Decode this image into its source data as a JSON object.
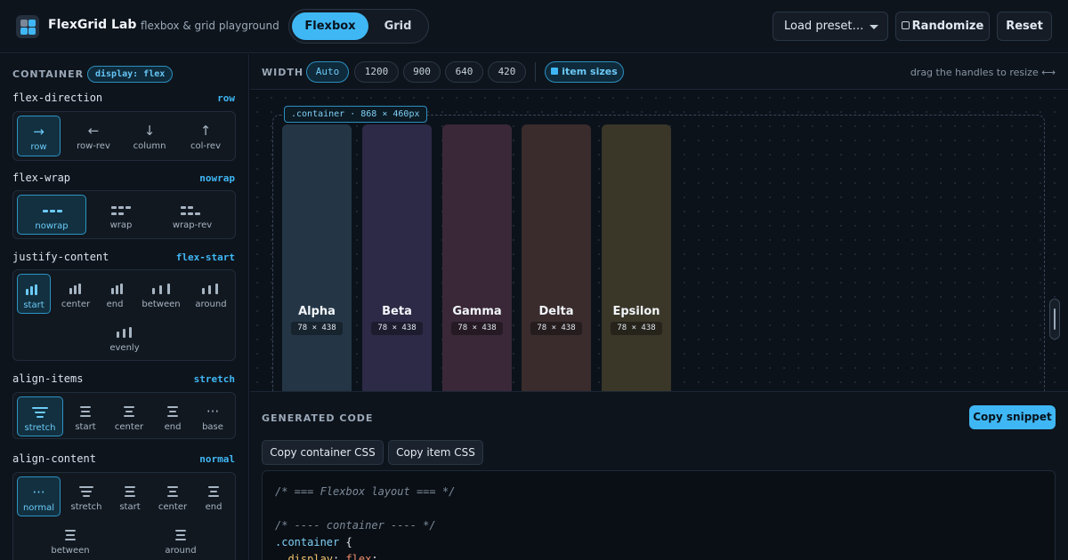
{
  "header": {
    "title": "FlexGrid Lab",
    "subtitle": "flexbox & grid playground",
    "modes": [
      "Flexbox",
      "Grid"
    ],
    "active_mode": "Flexbox",
    "preset_label": "Load preset…",
    "randomize_label": "Randomize",
    "reset_label": "Reset"
  },
  "sidebar": {
    "section": "CONTAINER",
    "badge": "display: flex",
    "flex_direction": {
      "name": "flex-direction",
      "value": "row",
      "options": [
        "row",
        "row-rev",
        "column",
        "col-rev"
      ]
    },
    "flex_wrap": {
      "name": "flex-wrap",
      "value": "nowrap",
      "options": [
        "nowrap",
        "wrap",
        "wrap-rev"
      ]
    },
    "justify_content": {
      "name": "justify-content",
      "value": "flex-start",
      "options": [
        "start",
        "center",
        "end",
        "between",
        "around",
        "evenly"
      ]
    },
    "align_items": {
      "name": "align-items",
      "value": "stretch",
      "options": [
        "stretch",
        "start",
        "center",
        "end",
        "base"
      ]
    },
    "align_content": {
      "name": "align-content",
      "value": "normal",
      "options": [
        "normal",
        "stretch",
        "start",
        "center",
        "end",
        "between",
        "around"
      ]
    }
  },
  "toolbar": {
    "label": "WIDTH",
    "widths": [
      "Auto",
      "1200",
      "900",
      "640",
      "420"
    ],
    "selected_width": "Auto",
    "item_sizes_label": "item sizes",
    "hint": "drag the handles to resize ⟷"
  },
  "canvas": {
    "container_tag": ".container · 868 × 460px",
    "items": [
      {
        "name": "Alpha",
        "size": "78 × 438",
        "color": "#243646"
      },
      {
        "name": "Beta",
        "size": "78 × 438",
        "color": "#2d2a47"
      },
      {
        "name": "Gamma",
        "size": "78 × 438",
        "color": "#3a2838"
      },
      {
        "name": "Delta",
        "size": "78 × 438",
        "color": "#3a2c2d"
      },
      {
        "name": "Epsilon",
        "size": "78 × 438",
        "color": "#3a3729"
      }
    ]
  },
  "code_panel": {
    "title": "GENERATED CODE",
    "copy_snippet_label": "Copy snippet",
    "copy_container_label": "Copy container CSS",
    "copy_item_label": "Copy item CSS",
    "lines": {
      "l1": "/* === Flexbox layout === */",
      "l2": "/* ---- container ---- */",
      "l3_selector": ".container",
      "l3_brace": " {",
      "l4_prop": "display",
      "l4_value": "flex"
    }
  },
  "colors": {
    "accent": "#3fb7f4",
    "background": "#0b1017",
    "panel": "#0e141c"
  }
}
